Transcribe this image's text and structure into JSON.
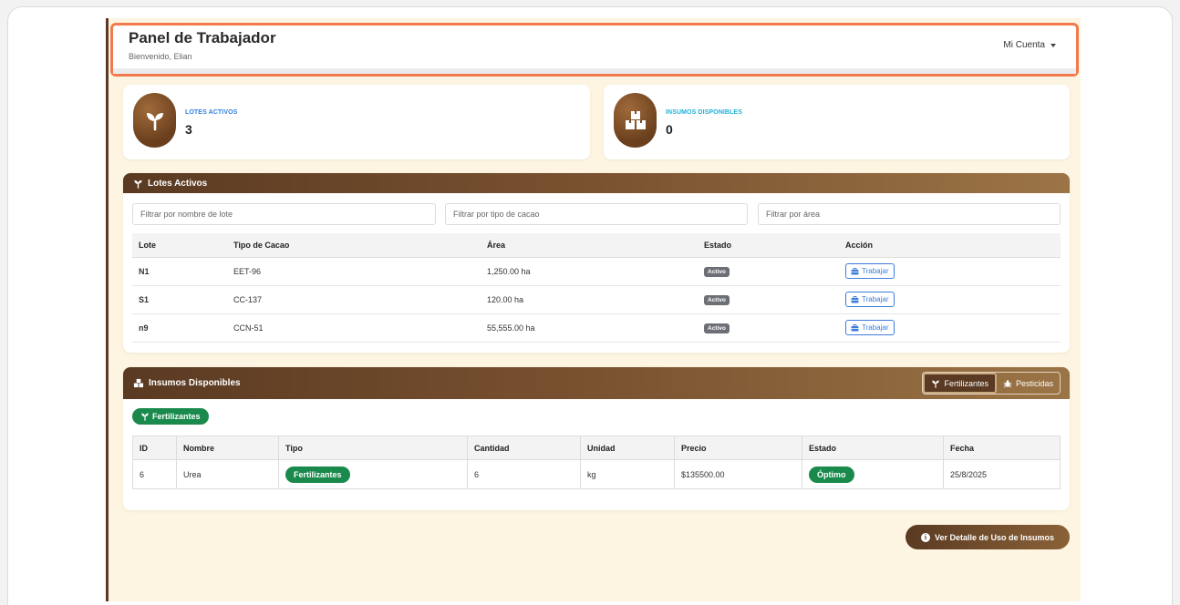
{
  "header": {
    "title": "Panel de Trabajador",
    "welcome": "Bienvenido, Elian",
    "account_label": "Mi Cuenta"
  },
  "stats": {
    "lotes": {
      "label": "LOTES ACTIVOS",
      "value": "3",
      "label_color": "#2f7fe0"
    },
    "insumos": {
      "label": "INSUMOS DISPONIBLES",
      "value": "0",
      "label_color": "#1fb0d8"
    }
  },
  "lotes_panel": {
    "title": "Lotes Activos",
    "filters": {
      "nombre_placeholder": "Filtrar por nombre de lote",
      "tipo_placeholder": "Filtrar por tipo de cacao",
      "area_placeholder": "Filtrar por área"
    },
    "columns": [
      "Lote",
      "Tipo de Cacao",
      "Área",
      "Estado",
      "Acción"
    ],
    "rows": [
      {
        "lote": "N1",
        "tipo": "EET-96",
        "area": "1,250.00 ha",
        "estado": "Activo",
        "accion": "Trabajar"
      },
      {
        "lote": "S1",
        "tipo": "CC-137",
        "area": "120.00 ha",
        "estado": "Activo",
        "accion": "Trabajar"
      },
      {
        "lote": "n9",
        "tipo": "CCN-51",
        "area": "55,555.00 ha",
        "estado": "Activo",
        "accion": "Trabajar"
      }
    ]
  },
  "insumos_panel": {
    "title": "Insumos Disponibles",
    "toggle_fertilizantes": "Fertilizantes",
    "toggle_pesticidas": "Pesticidas",
    "category_pill": "Fertilizantes",
    "columns": [
      "ID",
      "Nombre",
      "Tipo",
      "Cantidad",
      "Unidad",
      "Precio",
      "Estado",
      "Fecha"
    ],
    "rows": [
      {
        "id": "6",
        "nombre": "Urea",
        "tipo": "Fertilizantes",
        "cantidad": "6",
        "unidad": "kg",
        "precio": "$135500.00",
        "estado": "Óptimo",
        "fecha": "25/8/2025"
      }
    ]
  },
  "detail_button": "Ver Detalle de Uso de Insumos",
  "colors": {
    "accent_orange": "#f27a4d",
    "brown_dark": "#5a3a22",
    "brown_light": "#9b7446",
    "green": "#1a8a4c",
    "background": "#fdf5e1"
  }
}
